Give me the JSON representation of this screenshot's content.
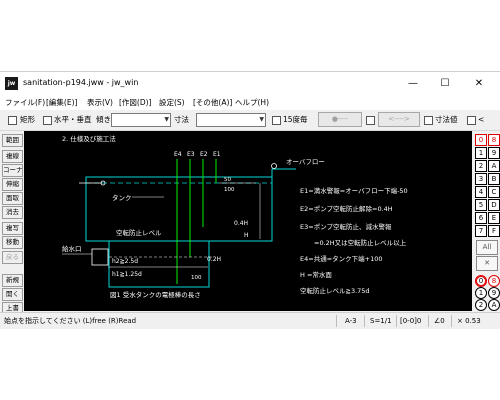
{
  "window": {
    "app_icon": "jw",
    "title": "sanitation-p194.jww - jw_win",
    "controls": {
      "minimize": "—",
      "maximize": "☐",
      "close": "✕"
    }
  },
  "menu": [
    "ファイル(F)",
    "[編集(E)]",
    "表示(V)",
    "[作図(D)]",
    "設定(S)",
    "[その他(A)]",
    "ヘルプ(H)"
  ],
  "toolbar": {
    "rect_label": "矩形",
    "hv_label": "水平・垂直",
    "tilt_label": "傾き",
    "dim_label": "寸法",
    "deg15_label": "15度毎",
    "btn_dot_line": "●----",
    "btn_arrow_both": "<---->",
    "dimval_label": "寸法値",
    "lt_label": "<"
  },
  "left_tools": [
    {
      "id": "hanni",
      "label": "範囲",
      "enabled": true
    },
    {
      "id": "senhoso",
      "label": "複線",
      "enabled": true
    },
    {
      "id": "corner",
      "label": "コーナー",
      "enabled": true
    },
    {
      "id": "nobasu",
      "label": "伸縮",
      "enabled": true
    },
    {
      "id": "mentori",
      "label": "面取",
      "enabled": true
    },
    {
      "id": "shokyo",
      "label": "消去",
      "enabled": true
    },
    {
      "id": "fukusha",
      "label": "複写",
      "enabled": true
    },
    {
      "id": "ido",
      "label": "移動",
      "enabled": true
    },
    {
      "id": "modosu",
      "label": "戻る",
      "enabled": false
    },
    {
      "id": "shinki",
      "label": "新規",
      "enabled": true
    },
    {
      "id": "hiraku",
      "label": "開く",
      "enabled": true
    },
    {
      "id": "uwagaki",
      "label": "上書",
      "enabled": true
    }
  ],
  "layers_numeric": [
    "0",
    "1",
    "2",
    "3",
    "4",
    "5",
    "6",
    "7"
  ],
  "layers_alpha": [
    "8",
    "9",
    "A",
    "B",
    "C",
    "D",
    "E",
    "F"
  ],
  "layer_all": "All",
  "layer_x": "✕",
  "layer_groups": [
    "0",
    "1",
    "2",
    "3"
  ],
  "layer_groups_r": [
    "8",
    "9",
    "A",
    "B"
  ],
  "drawing": {
    "heading": "2. 仕様及び施工法",
    "e_labels": [
      "E4",
      "E3",
      "E2",
      "E1"
    ],
    "overflow_label": "オーバフロー",
    "tank_label": "タンク",
    "idle_level": "空転防止レベル",
    "inlet_label": "給水口",
    "dim_50": "50",
    "dim_100": "100",
    "dim_04h": "0.4H",
    "dim_02h": "0.2H",
    "dim_h": "H",
    "dim_h2": "h2≧2.5d",
    "dim_h1": "h1≧1.25d",
    "dim_100b": "100",
    "caption": "図1 受水タンクの電極棒の長さ",
    "notes": [
      "E1=満水警報=オーバフロー下端-50",
      "E2=ポンプ空転防止解除=0.4H",
      "E3=ポンプ空転防止、減水警報",
      "=0.2H又は空転防止レベル以上",
      "E4=共通=タンク下端+100",
      "H =常水面",
      "空転防止レベル≧3.75d"
    ]
  },
  "status": {
    "message": "始点を指示してください (L)free (R)Read",
    "paper": "A-3",
    "scale": "S=1/1",
    "layer": "[0-0]0",
    "angle": "∠0",
    "zoom": "× 0.53"
  }
}
